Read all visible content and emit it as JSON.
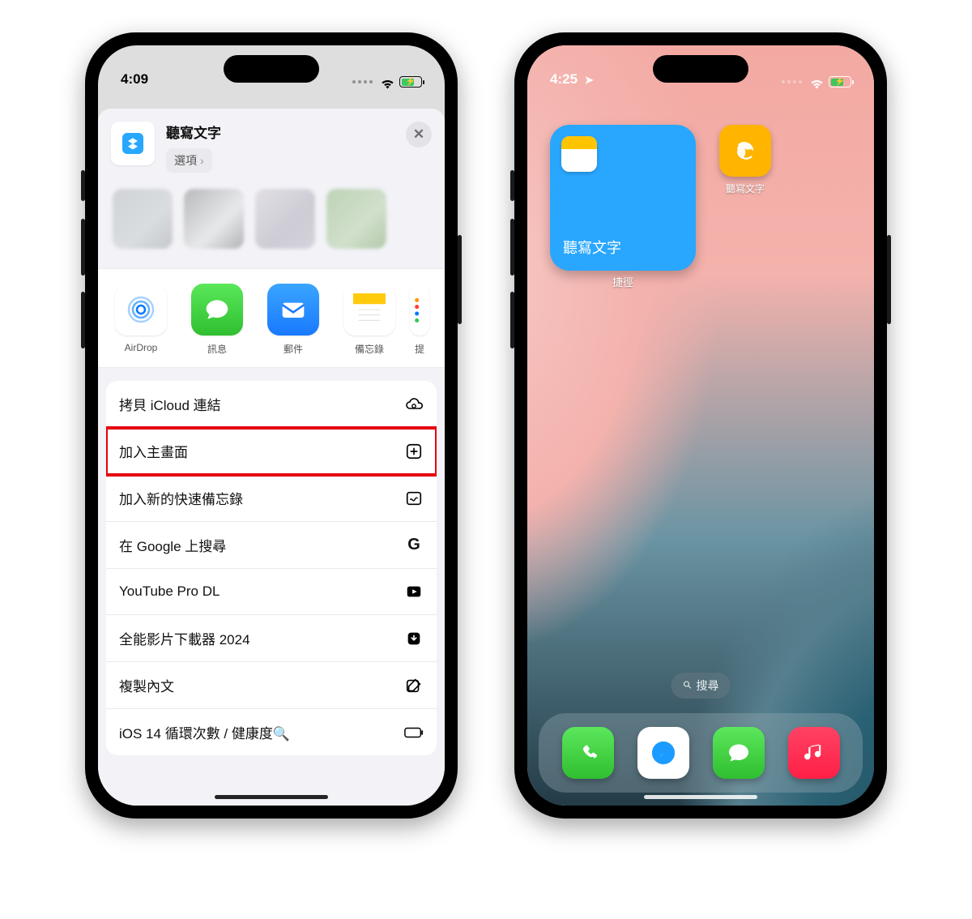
{
  "left": {
    "status": {
      "time": "4:09"
    },
    "sheet": {
      "title": "聽寫文字",
      "options": "選項",
      "apps": [
        {
          "label": "AirDrop"
        },
        {
          "label": "訊息"
        },
        {
          "label": "郵件"
        },
        {
          "label": "備忘錄"
        },
        {
          "label": "提"
        }
      ],
      "actions": [
        {
          "label": "拷貝 iCloud 連結",
          "icon": "cloud-link"
        },
        {
          "label": "加入主畫面",
          "icon": "plus-square",
          "highlight": true
        },
        {
          "label": "加入新的快速備忘錄",
          "icon": "quick-note"
        },
        {
          "label": "在 Google 上搜尋",
          "icon": "google"
        },
        {
          "label": "YouTube Pro DL",
          "icon": "play-square"
        },
        {
          "label": "全能影片下載器 2024",
          "icon": "download"
        },
        {
          "label": "複製內文",
          "icon": "compose"
        },
        {
          "label": "iOS 14 循環次數 / 健康度🔍",
          "icon": "battery"
        }
      ]
    }
  },
  "right": {
    "status": {
      "time": "4:25"
    },
    "widget": {
      "title": "聽寫文字",
      "caption": "捷徑"
    },
    "app_icon": {
      "label": "聽寫文字"
    },
    "search": "搜尋",
    "dock": [
      "phone",
      "safari",
      "messages",
      "music"
    ]
  }
}
